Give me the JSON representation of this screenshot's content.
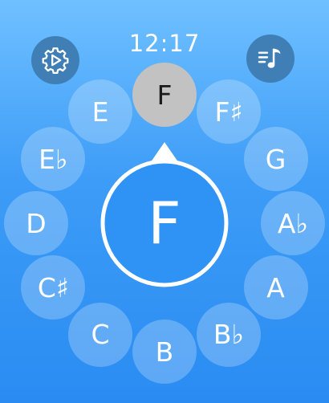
{
  "clock": {
    "time": "12:17"
  },
  "top_bar": {
    "settings_icon": "gear-play-icon",
    "music_icon": "music-list-icon"
  },
  "current_note": "F",
  "notes": [
    {
      "label": "F",
      "selected": true
    },
    {
      "label": "F♯",
      "selected": false
    },
    {
      "label": "G",
      "selected": false
    },
    {
      "label": "A♭",
      "selected": false
    },
    {
      "label": "A",
      "selected": false
    },
    {
      "label": "B♭",
      "selected": false
    },
    {
      "label": "B",
      "selected": false
    },
    {
      "label": "C",
      "selected": false
    },
    {
      "label": "C♯",
      "selected": false
    },
    {
      "label": "D",
      "selected": false
    },
    {
      "label": "E♭",
      "selected": false
    },
    {
      "label": "E",
      "selected": false
    }
  ],
  "colors": {
    "background_top": "#6fc0ff",
    "background_bottom": "#2a8cf2",
    "center_circle": "#2f93f5",
    "selected_note": "#c2c2c2",
    "corner_button": "#3f7fb6"
  }
}
